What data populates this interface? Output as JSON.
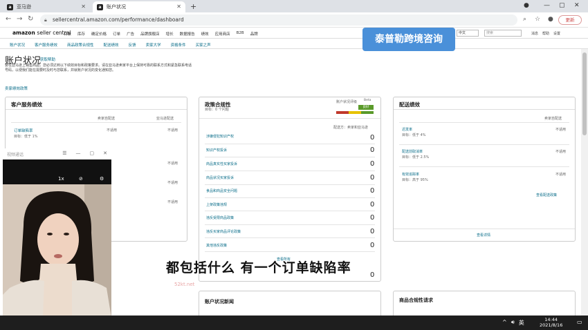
{
  "browser": {
    "tabs": [
      {
        "title": "亚马逊",
        "favicon": "a"
      },
      {
        "title": "账户状况",
        "favicon": "a"
      }
    ],
    "url": "sellercentral.amazon.com/performance/dashboard",
    "update_label": "更新"
  },
  "amazon_header": {
    "logo_brand": "amazon",
    "logo_product": "seller central",
    "nav_items": [
      "目录",
      "库存",
      "确定价格",
      "订单",
      "广告",
      "品牌旗舰店",
      "增长",
      "数据报告",
      "绩效",
      "应用商店",
      "B2B",
      "品牌"
    ],
    "language": "中文",
    "search_placeholder": "搜索",
    "right_links": [
      "消息",
      "帮助",
      "设置"
    ],
    "sub_nav": [
      "账户状况",
      "客户服务绩效",
      "商品政策合规性",
      "配送绩效",
      "反馈",
      "卖家大学",
      "资格条件",
      "买家之声"
    ]
  },
  "page": {
    "title": "账户状况",
    "help_link": "获取帮助",
    "intro": "要在亚马逊上销售商品，您必须达到以下绩效目标和政策要求。请在亚马逊卖家平台上保持可靠的联系方式和紧急联系电话号码，以便我们能在需要时及时与您联系，并就账户状况的变化通知您。",
    "policy_link": "卖家绩效政策",
    "watermark_badge": "泰普勒跨境咨询"
  },
  "customer_service": {
    "title": "客户服务绩效",
    "col_seller": "卖家自配送",
    "col_fba": "亚马逊配送",
    "odr_label": "订单缺陷率",
    "odr_target": "目标：低于 1%",
    "not_applicable": "不适用"
  },
  "policy_compliance": {
    "title": "政策合规性",
    "subtitle": "目标：0 个问题",
    "rating_label": "账户状况评级",
    "rating_beta": "Beta",
    "rating_status": "良好",
    "fulfill_note": "配送方：卖家和亚马逊",
    "items": [
      {
        "label": "涉嫌侵犯知识产权",
        "count": "0"
      },
      {
        "label": "知识产权投诉",
        "count": "0"
      },
      {
        "label": "商品真实性买家投诉",
        "count": "0"
      },
      {
        "label": "商品状况买家投诉",
        "count": "0"
      },
      {
        "label": "食品和商品安全问题",
        "count": "0"
      },
      {
        "label": "上架政策违规",
        "count": "0"
      },
      {
        "label": "违反受限商品政策",
        "count": "0"
      },
      {
        "label": "违反买家商品评论政策",
        "count": "0"
      },
      {
        "label": "其他违反政策",
        "count": "0"
      },
      {
        "label": "查看所有",
        "count": "0"
      }
    ]
  },
  "shipping": {
    "title": "配送绩效",
    "col_seller": "卖家自配送",
    "items": [
      {
        "label": "迟发率",
        "target": "目标：低于 4%",
        "value": "不适用"
      },
      {
        "label": "配送前取消率",
        "target": "目标：低于 2.5%",
        "value": "不适用"
      },
      {
        "label": "有效追踪率",
        "target": "目标：高于 95%",
        "value": "不适用"
      }
    ],
    "policy_link": "查看配送政策",
    "details_link": "查看详情"
  },
  "bottom_cards": {
    "account_health_news": "账户状况新闻",
    "product_compliance": "商品合规性请求"
  },
  "video": {
    "title": "视频通话"
  },
  "subtitle": "都包括什么  有一个订单缺陷率",
  "watermark_text": "52kt.net",
  "taskbar": {
    "time": "14:44",
    "date": "2021/8/16",
    "ime": "英"
  },
  "colors": {
    "link": "#0b6e8a",
    "badge": "#4a90d9",
    "rating_good": "#5a9a2a",
    "rating_bad": "#c0392b",
    "rating_warn": "#e6c200"
  }
}
